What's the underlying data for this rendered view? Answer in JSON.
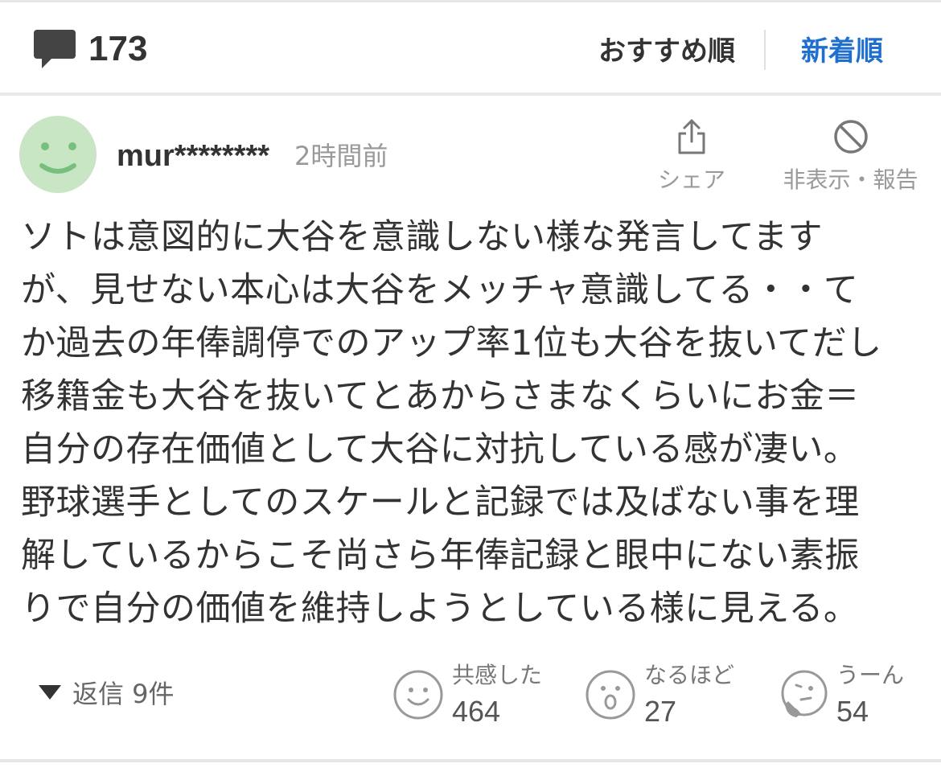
{
  "header": {
    "comment_count": "173",
    "sort_recommended": "おすすめ順",
    "sort_newest": "新着順",
    "active_sort_color": "#1f6fd0"
  },
  "comment": {
    "username": "mur********",
    "time": "2時間前",
    "share_label": "シェア",
    "hide_report_label": "非表示・報告",
    "lines": [
      "ソトは意図的に大谷を意識しない様な発言してます",
      "が、見せない本心は大谷をメッチャ意識してる・・て",
      "か過去の年俸調停でのアップ率1位も大谷を抜いてだし",
      "移籍金も大谷を抜いてとあからさまなくらいにお金＝",
      "自分の存在価値として大谷に対抗している感が凄い。",
      "野球選手としてのスケールと記録では及ばない事を理",
      "解しているからこそ尚さら年俸記録と眼中にない素振",
      "りで自分の価値を維持しようとしている様に見える。"
    ],
    "replies": "返信 9件",
    "reactions": [
      {
        "label": "共感した",
        "count": "464",
        "icon": "smile-face-icon"
      },
      {
        "label": "なるほど",
        "count": "27",
        "icon": "surprised-face-icon"
      },
      {
        "label": "うーん",
        "count": "54",
        "icon": "thinking-face-icon"
      }
    ],
    "avatar_color": "#c9e6c4",
    "avatar_face_color": "#78be7e"
  }
}
